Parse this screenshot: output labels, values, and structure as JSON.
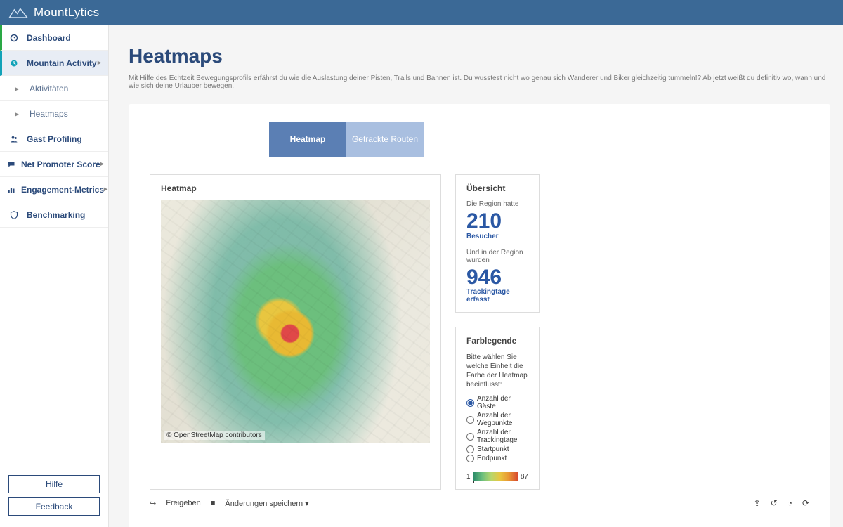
{
  "brand": {
    "name": "MountLytics"
  },
  "nav": {
    "items": [
      {
        "label": "Dashboard",
        "icon": "dashboard-icon",
        "chev": false
      },
      {
        "label": "Mountain Activity",
        "icon": "clock-icon",
        "chev": true,
        "active": true
      },
      {
        "label": "Aktivitäten",
        "icon": "caret-icon",
        "chev": false,
        "sub": true
      },
      {
        "label": "Heatmaps",
        "icon": "caret-icon",
        "chev": false,
        "sub": true
      },
      {
        "label": "Gast Profiling",
        "icon": "users-icon",
        "chev": false
      },
      {
        "label": "Net Promoter Score",
        "icon": "chat-icon",
        "chev": true
      },
      {
        "label": "Engagement-Metrics",
        "icon": "bars-icon",
        "chev": true
      },
      {
        "label": "Benchmarking",
        "icon": "shield-icon",
        "chev": false
      }
    ]
  },
  "sidebar_buttons": {
    "help": "Hilfe",
    "feedback": "Feedback"
  },
  "page": {
    "title": "Heatmaps",
    "subtitle": "Mit Hilfe des Echtzeit Bewegungsprofils erfährst du wie die Auslastung deiner Pisten, Trails und Bahnen ist. Du wusstest nicht wo genau sich Wanderer und Biker gleichzeitig tummeln!? Ab jetzt weißt du definitiv wo, wann und wie sich deine Urlauber bewegen."
  },
  "tabs": [
    {
      "label": "Heatmap"
    },
    {
      "label": "Getrackte Routen"
    }
  ],
  "map": {
    "panel_title": "Heatmap",
    "attribution": "© OpenStreetMap contributors"
  },
  "overview": {
    "title": "Übersicht",
    "line1": "Die Region hatte",
    "visitors": "210",
    "visitors_label": "Besucher",
    "line2": "Und in der Region wurden",
    "trackingdays": "946",
    "trackingdays_label": "Trackingtage erfasst"
  },
  "legend": {
    "title": "Farblegende",
    "prompt": "Bitte wählen Sie welche Einheit die Farbe der Heatmap beeinflusst:",
    "options": [
      "Anzahl der Gäste",
      "Anzahl der Wegpunkte",
      "Anzahl der Trackingtage",
      "Startpunkt",
      "Endpunkt"
    ],
    "scale_min": "1",
    "scale_max": "87"
  },
  "toolbar": {
    "share": "Freigeben",
    "save": "Änderungen speichern"
  }
}
